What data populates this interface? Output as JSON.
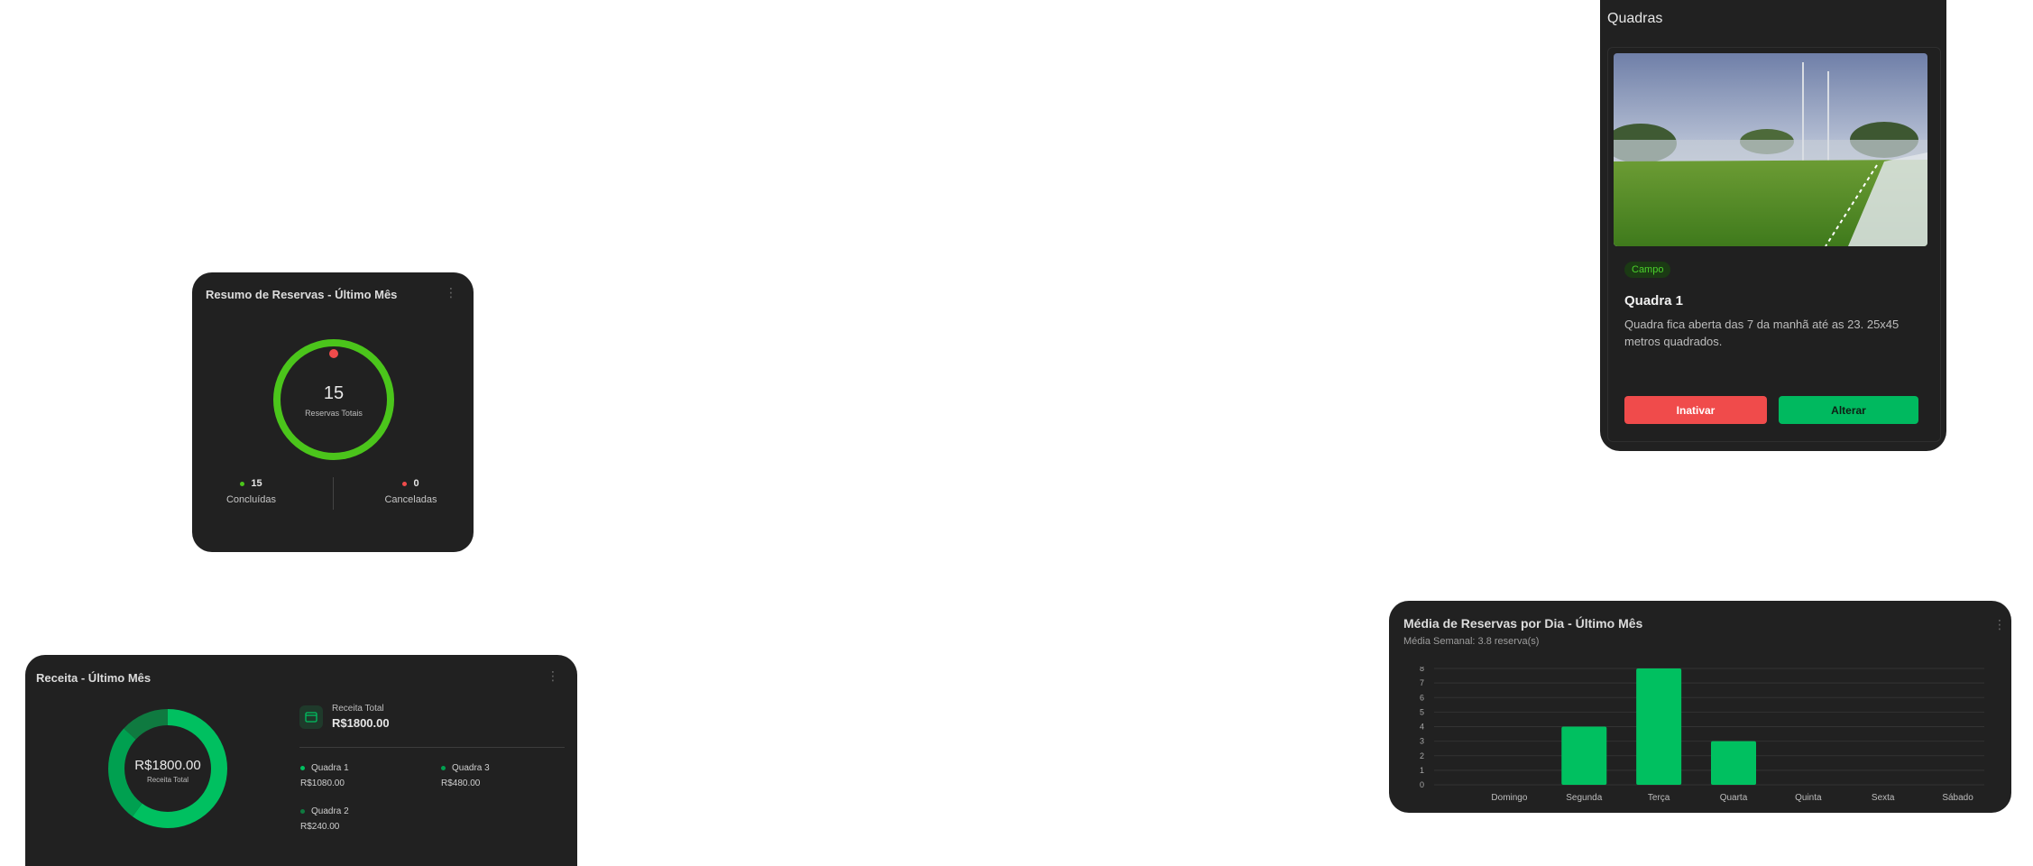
{
  "resumo": {
    "title": "Resumo de Reservas - Último Mês",
    "total": "15",
    "total_label": "Reservas Totais",
    "concluidas": {
      "value": "15",
      "label": "Concluídas",
      "color": "#4bc51b"
    },
    "canceladas": {
      "value": "0",
      "label": "Canceladas",
      "color": "#f04b4b"
    },
    "ring_color": "#4bc51b",
    "marker_color": "#f04b4b"
  },
  "receita": {
    "title": "Receita - Último Mês",
    "total_value": "R$1800.00",
    "total_label": "Receita Total",
    "header_label": "Receita Total",
    "header_value": "R$1800.00",
    "items": [
      {
        "name": "Quadra 1",
        "value": "R$1080.00",
        "color": "#00c060"
      },
      {
        "name": "Quadra 3",
        "value": "R$480.00",
        "color": "#00a050"
      },
      {
        "name": "Quadra 2",
        "value": "R$240.00",
        "color": "#0f7a40"
      }
    ]
  },
  "quadras": {
    "title": "Quadras",
    "card": {
      "badge": "Campo",
      "name": "Quadra 1",
      "description": "Quadra fica aberta das 7 da manhã até as 23. 25x45 metros quadrados.",
      "btn_inactivate": "Inativar",
      "btn_edit": "Alterar"
    }
  },
  "media": {
    "title": "Média de Reservas por Dia - Último Mês",
    "subtitle": "Média Semanal: 3.8 reserva(s)"
  },
  "chart_data": {
    "type": "bar",
    "categories": [
      "Domingo",
      "Segunda",
      "Terça",
      "Quarta",
      "Quinta",
      "Sexta",
      "Sábado"
    ],
    "values": [
      0,
      4,
      8,
      3,
      0,
      0,
      0
    ],
    "ylim": [
      0,
      8
    ],
    "yticks": [
      0,
      1,
      2,
      3,
      4,
      5,
      6,
      7,
      8
    ],
    "grid": true,
    "bar_color": "#00c060"
  }
}
